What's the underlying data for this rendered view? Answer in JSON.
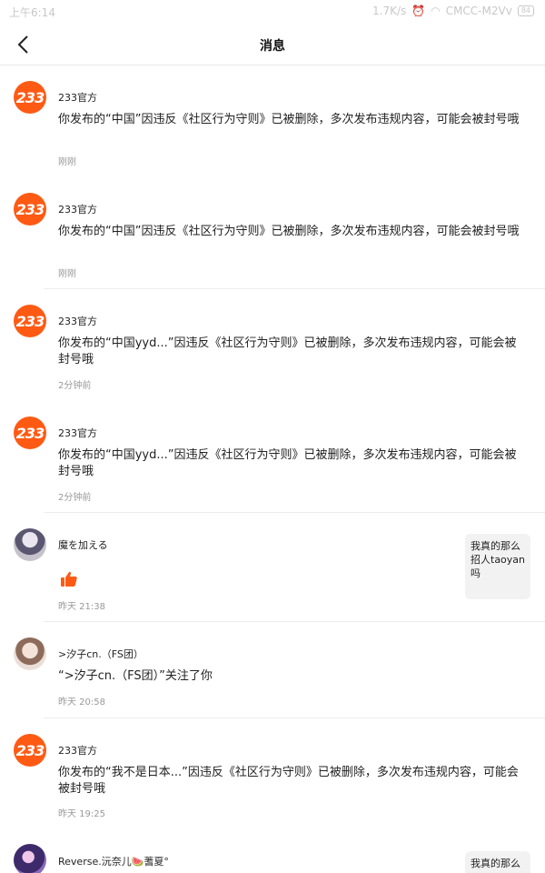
{
  "status": {
    "time": "上午6:14",
    "speed": "1.7K/s",
    "carrier": "CMCC-M2Vv",
    "battery": "84"
  },
  "header": {
    "title": "消息"
  },
  "messages": [
    {
      "name": "233官方",
      "content": "你发布的“中国”因违反《社区行为守则》已被删除，多次发布违规内容，可能会被封号哦",
      "time": "刚刚"
    },
    {
      "name": "233官方",
      "content": "你发布的“中国”因违反《社区行为守则》已被删除，多次发布违规内容，可能会被封号哦",
      "time": "刚刚"
    },
    {
      "name": "233官方",
      "content": "你发布的“中国yyd...”因违反《社区行为守则》已被删除，多次发布违规内容，可能会被封号哦",
      "time": "2分钟前"
    },
    {
      "name": "233官方",
      "content": "你发布的“中国yyd...”因违反《社区行为守则》已被删除，多次发布违规内容，可能会被封号哦",
      "time": "2分钟前"
    },
    {
      "name": "魔を加える",
      "time": "昨天 21:38",
      "side": "我真的那么招人taoyan吗"
    },
    {
      "name": ">汐子cn.（FS团）",
      "content": "“>汐子cn.（FS团）”关注了你",
      "time": "昨天 20:58"
    },
    {
      "name": "233官方",
      "content": "你发布的“我不是日本...”因违反《社区行为守则》已被删除，多次发布违规内容，可能会被封号哦",
      "time": "昨天 19:25"
    },
    {
      "name": "Reverse.沅奈儿🍉蓍夏°",
      "side": "我真的那么"
    }
  ],
  "avatars": {
    "official": "233"
  },
  "colors": {
    "brand": "#ff5a14"
  }
}
